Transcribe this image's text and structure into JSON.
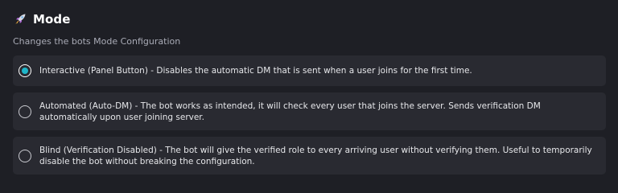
{
  "section": {
    "title": "Mode",
    "subtitle": "Changes the bots Mode Configuration",
    "icon": "rocket-icon"
  },
  "colors": {
    "background": "#1e1f25",
    "card": "#292a31",
    "accent": "#1fb6c9"
  },
  "options": [
    {
      "label": "Interactive (Panel Button) - Disables the automatic DM that is sent when a user joins for the first time.",
      "selected": true
    },
    {
      "label": "Automated (Auto-DM) - The bot works as intended, it will check every user that joins the server. Sends verification DM automatically upon user joining server.",
      "selected": false
    },
    {
      "label": "Blind (Verification Disabled) - The bot will give the verified role to every arriving user without verifying them. Useful to temporarily disable the bot without breaking the configuration.",
      "selected": false
    }
  ]
}
